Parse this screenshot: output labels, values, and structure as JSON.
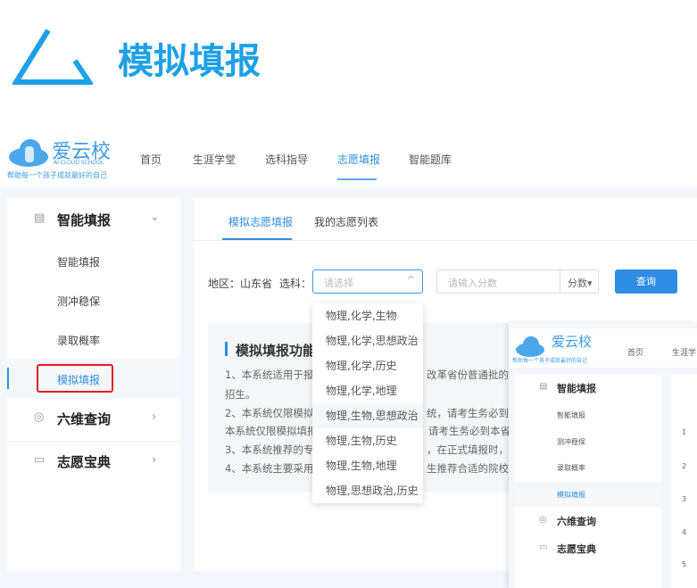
{
  "page_title": "模拟填报",
  "brand": {
    "name": "爱云校",
    "sub": "AI·CLOUD·SCHOOL",
    "slogan": "帮助每一个孩子成就最好的自己"
  },
  "nav": [
    "首页",
    "生涯学堂",
    "选科指导",
    "志愿填报",
    "智能题库"
  ],
  "sidebar": {
    "group1": "智能填报",
    "items": [
      "智能填报",
      "测冲稳保",
      "录取概率",
      "模拟填报"
    ],
    "group2": "六维查询",
    "group3": "志愿宝典"
  },
  "tabs": [
    "模拟志愿填报",
    "我的志愿列表"
  ],
  "filter": {
    "region": "地区：山东省",
    "subject_label": "选科：",
    "subject_placeholder": "请选择",
    "score_placeholder": "请输入分数",
    "score_unit": "分数▾",
    "query": "查询"
  },
  "options": [
    "物理,化学,生物",
    "物理,化学,思想政治",
    "物理,化学,历史",
    "物理,化学,地理",
    "物理,生物,思想政治",
    "物理,生物,历史",
    "物理,生物,地理",
    "物理,思想政治,历史"
  ],
  "info": {
    "title": "模拟填报功能",
    "lines": [
      "1、本系统适用于报考",
      "改革省份普通批的本",
      "招生。",
      "2、本系统仅限模拟填",
      "统，请考生务必到本",
      "本系统仅限模拟填报",
      "请考生务必到本省",
      "3、本系统推荐的专业",
      "，在正式填报时，以",
      "4、本系统主要采用",
      "生推荐合适的院校。"
    ]
  },
  "inset": {
    "nav": [
      "首页",
      "生涯学"
    ],
    "row_numbers": [
      "1",
      "2",
      "3",
      "4",
      "5"
    ]
  }
}
